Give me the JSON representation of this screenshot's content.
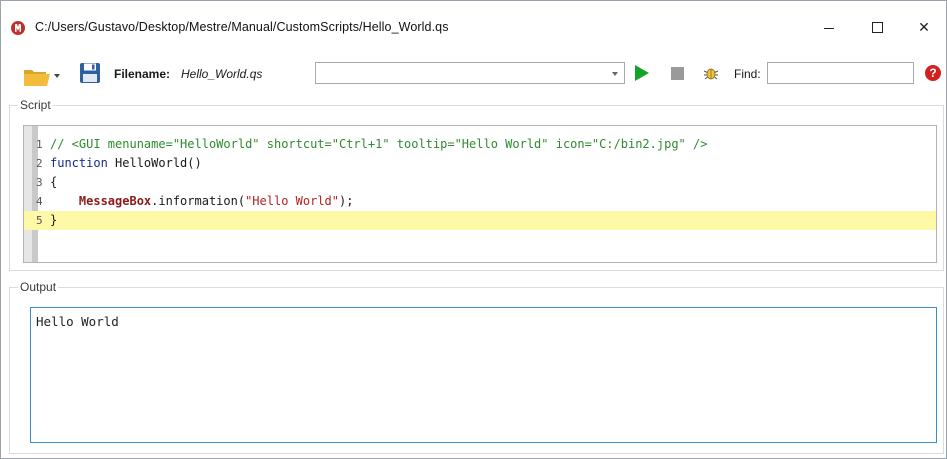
{
  "window": {
    "title": "C:/Users/Gustavo/Desktop/Mestre/Manual/CustomScripts/Hello_World.qs",
    "close_glyph": "✕"
  },
  "toolbar": {
    "filename_label": "Filename:",
    "filename_value": "Hello_World.qs",
    "script_combo_value": "",
    "find_label": "Find:",
    "find_value": "",
    "help_glyph": "?"
  },
  "icons": {
    "app": "app-logo-icon",
    "open": "folder-open-icon",
    "save": "floppy-disk-icon",
    "run": "play-icon",
    "stop": "stop-icon",
    "debug": "bug-icon",
    "help": "help-icon"
  },
  "colors": {
    "run": "#14a329",
    "help": "#d21f1f",
    "current_line": "#fdf9a6",
    "output_border": "#3b8fd1"
  },
  "script": {
    "group_title": "Script",
    "lines": [
      {
        "num": "1",
        "parts": [
          {
            "cls": "c-comment",
            "text": "// <GUI menuname=\"HelloWorld\" shortcut=\"Ctrl+1\" tooltip=\"Hello World\" icon=\"C:/bin2.jpg\" />"
          }
        ]
      },
      {
        "num": "2",
        "parts": [
          {
            "cls": "c-keyword",
            "text": "function "
          },
          {
            "cls": "c-plain",
            "text": "HelloWorld()"
          }
        ]
      },
      {
        "num": "3",
        "parts": [
          {
            "cls": "c-plain",
            "text": "{"
          }
        ]
      },
      {
        "num": "4",
        "parts": [
          {
            "cls": "c-plain",
            "text": "    "
          },
          {
            "cls": "c-builtin",
            "text": "MessageBox"
          },
          {
            "cls": "c-plain",
            "text": ".information("
          },
          {
            "cls": "c-string",
            "text": "\"Hello World\""
          },
          {
            "cls": "c-plain",
            "text": ");"
          }
        ]
      },
      {
        "num": "5",
        "parts": [
          {
            "cls": "c-plain",
            "text": "}"
          }
        ],
        "current": true
      }
    ]
  },
  "output": {
    "group_title": "Output",
    "text": "Hello World"
  }
}
